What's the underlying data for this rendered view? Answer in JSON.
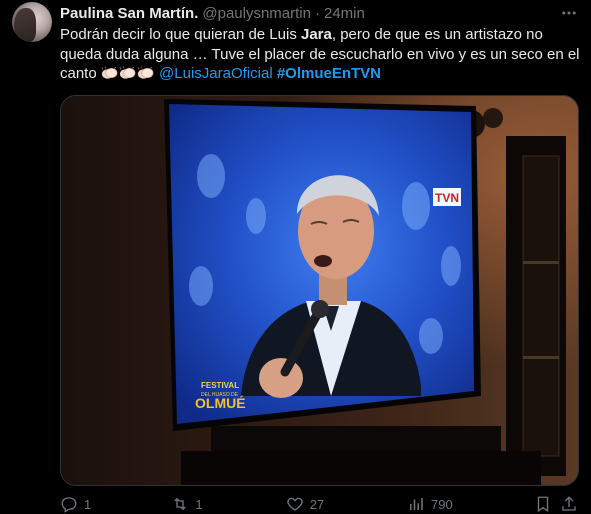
{
  "tweet": {
    "author_name": "Paulina San Martín.",
    "handle": "@paulysnmartin",
    "separator": "·",
    "time": "24min",
    "text": {
      "part1": "Podrán decir lo que quieran de Luis ",
      "bold": "Jara",
      "part2": ", pero de que es un artistazo no queda duda alguna … Tuve el placer de escucharlo en vivo y es un seco en el canto ",
      "mention": "@LuisJaraOficial",
      "hashtag": "#OlmueEnTVN"
    },
    "media": {
      "logo_text": "TVN",
      "festival_text": "FESTIVAL",
      "festival_sub": "DEL HUASO DE",
      "olmue_text": "OLMUÉ"
    }
  },
  "actions": {
    "replies": "1",
    "reposts": "1",
    "likes": "27",
    "views": "790"
  },
  "colors": {
    "background": "#000000",
    "text": "#e7e9ea",
    "secondary": "#71767b",
    "link": "#1d9bf0"
  }
}
